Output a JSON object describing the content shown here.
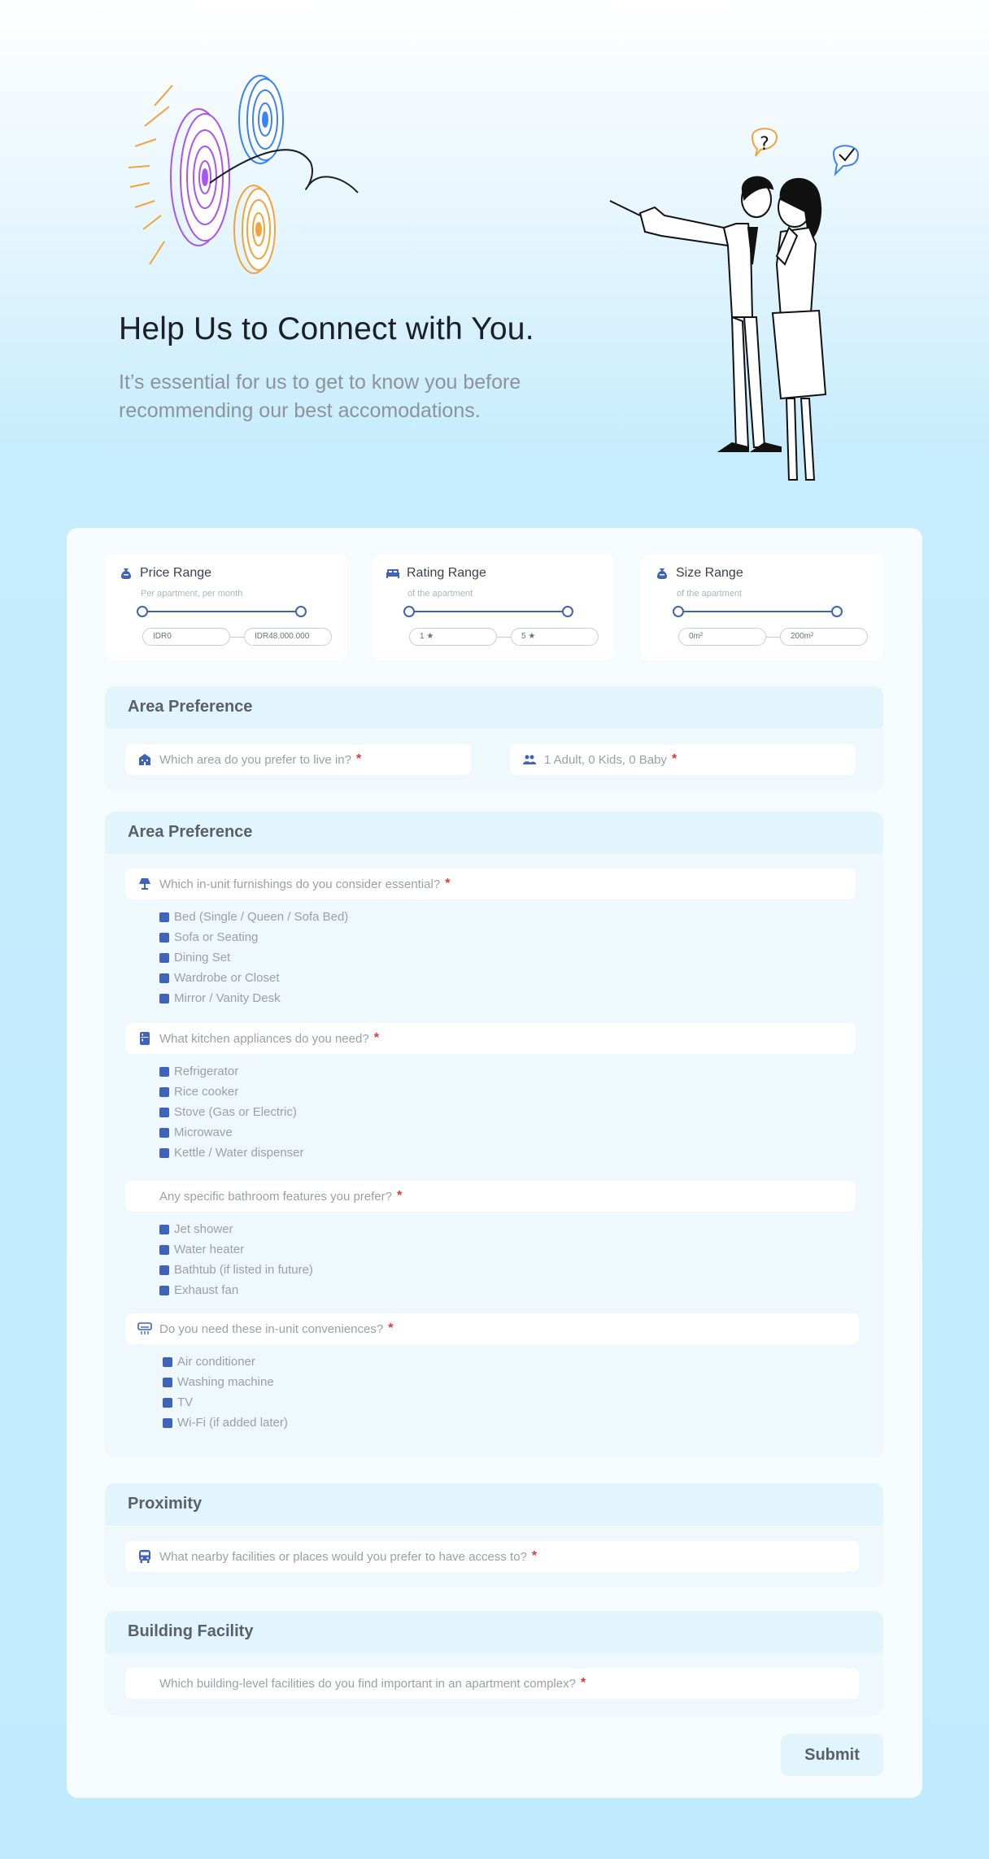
{
  "hero": {
    "title": "Help Us to Connect with You.",
    "subtitle": "It’s essential for us to get to know you before recommending our best accomodations."
  },
  "ranges": [
    {
      "title": "Price Range",
      "subtitle": "Per apartment, per month",
      "min": "IDR0",
      "max": "IDR48.000.000",
      "icon": "money-bag-icon"
    },
    {
      "title": "Rating Range",
      "subtitle": "of the apartment",
      "min": "1 ★",
      "max": "5 ★",
      "icon": "bed-icon"
    },
    {
      "title": "Size Range",
      "subtitle": "of the apartment",
      "min": "0m²",
      "max": "200m²",
      "icon": "money-bag-icon"
    }
  ],
  "area_pref": {
    "title": "Area Preference",
    "area_placeholder": "Which area do you prefer to live in?",
    "guests_placeholder": "1 Adult, 0 Kids, 0 Baby"
  },
  "unit_pref": {
    "title": "Area Preference",
    "furnishings_q": "Which in-unit furnishings do you consider essential?",
    "furnishings": [
      "Bed (Single / Queen / Sofa Bed)",
      "Sofa or Seating",
      "Dining Set",
      "Wardrobe or Closet",
      "Mirror / Vanity Desk"
    ],
    "kitchen_q": "What kitchen appliances do you need?",
    "kitchen": [
      "Refrigerator",
      "Rice cooker",
      "Stove (Gas or Electric)",
      "Microwave",
      "Kettle / Water dispenser"
    ],
    "bathroom_q": "Any specific bathroom features you prefer?",
    "bathroom": [
      "Jet shower",
      "Water heater",
      "Bathtub (if listed in future)",
      "Exhaust fan"
    ],
    "conveniences_q": "Do you need these in-unit conveniences?",
    "conveniences": [
      "Air conditioner",
      "Washing machine",
      "TV",
      "Wi-Fi (if added later)"
    ]
  },
  "proximity": {
    "title": "Proximity",
    "question": "What nearby facilities or places would you prefer to have access to?"
  },
  "building": {
    "title": "Building Facility",
    "question": "Which building-level facilities do you find important in an apartment complex?"
  },
  "required_mark": "*",
  "submit_label": "Submit",
  "colors": {
    "accent": "#3f63b8",
    "required": "#e5363b",
    "section_header": "#e2f5fc"
  }
}
